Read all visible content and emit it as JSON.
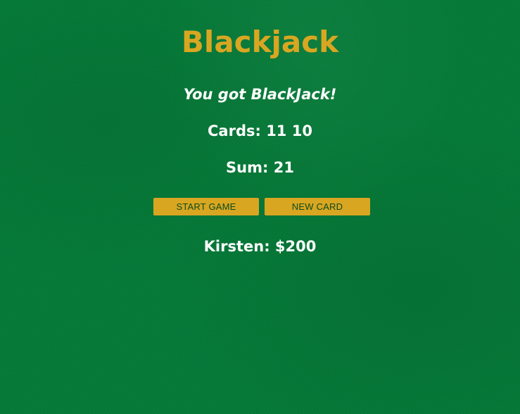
{
  "game": {
    "title": "Blackjack",
    "message": "You got BlackJack!",
    "cards_text": "Cards: 11 10",
    "sum_text": "Sum: 21",
    "player_text": "Kirsten: $200"
  },
  "buttons": {
    "start_label": "START GAME",
    "new_card_label": "NEW CARD"
  },
  "colors": {
    "felt": "#057a38",
    "accent": "#d9a621",
    "button_text": "#0b4a1e",
    "text": "#ffffff"
  }
}
